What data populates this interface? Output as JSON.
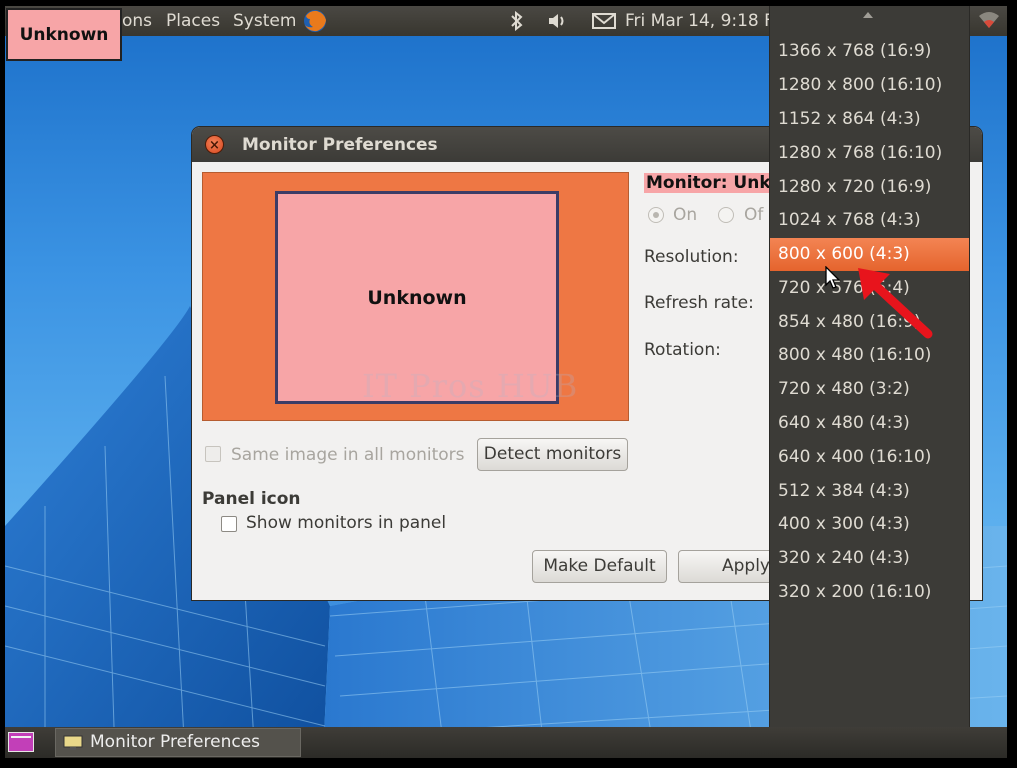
{
  "top_panel": {
    "menu_applications": "ons",
    "menu_places": "Places",
    "menu_system": "System",
    "clock": "Fri Mar 14,  9:18 F"
  },
  "desktop_tag": "Unknown",
  "window": {
    "title": "Monitor Preferences",
    "preview_monitor_label": "Unknown",
    "watermark": "IT Pros HUB",
    "monitor_heading": "Monitor: Unkn",
    "radio_on": "On",
    "radio_off": "Of",
    "resolution_label": "Resolution:",
    "refresh_label": "Refresh rate:",
    "rotation_label": "Rotation:",
    "same_image_label": "Same image in all monitors",
    "detect_button": "Detect monitors",
    "panel_icon_heading": "Panel icon",
    "show_monitors_label": "Show monitors in panel",
    "make_default_button": "Make Default",
    "apply_button": "Apply"
  },
  "resolution_dropdown": {
    "selected": "800 x 600 (4:3)",
    "options": [
      "1366 x 768 (16:9)",
      "1280 x 800 (16:10)",
      "1152 x 864 (4:3)",
      "1280 x 768 (16:10)",
      "1280 x 720 (16:9)",
      "1024 x 768 (4:3)",
      "800 x 600 (4:3)",
      "720 x 576 (5:4)",
      "854 x 480 (16:9)",
      "800 x 480 (16:10)",
      "720 x 480 (3:2)",
      "640 x 480 (4:3)",
      "640 x 400 (16:10)",
      "512 x 384 (4:3)",
      "400 x 300 (4:3)",
      "320 x 240 (4:3)",
      "320 x 200 (16:10)"
    ]
  },
  "taskbar": {
    "task_label": "Monitor Preferences"
  },
  "colors": {
    "accent": "#e96d37",
    "panel": "#3c3b37",
    "monitor_fill": "#f7a5a7",
    "annotation_arrow": "#e8141c"
  },
  "icons": [
    "firefox-icon",
    "bluetooth-icon",
    "volume-icon",
    "mail-icon",
    "wifi-icon",
    "close-icon",
    "show-desktop-icon",
    "display-icon",
    "mouse-cursor-icon",
    "red-arrow-annotation"
  ]
}
